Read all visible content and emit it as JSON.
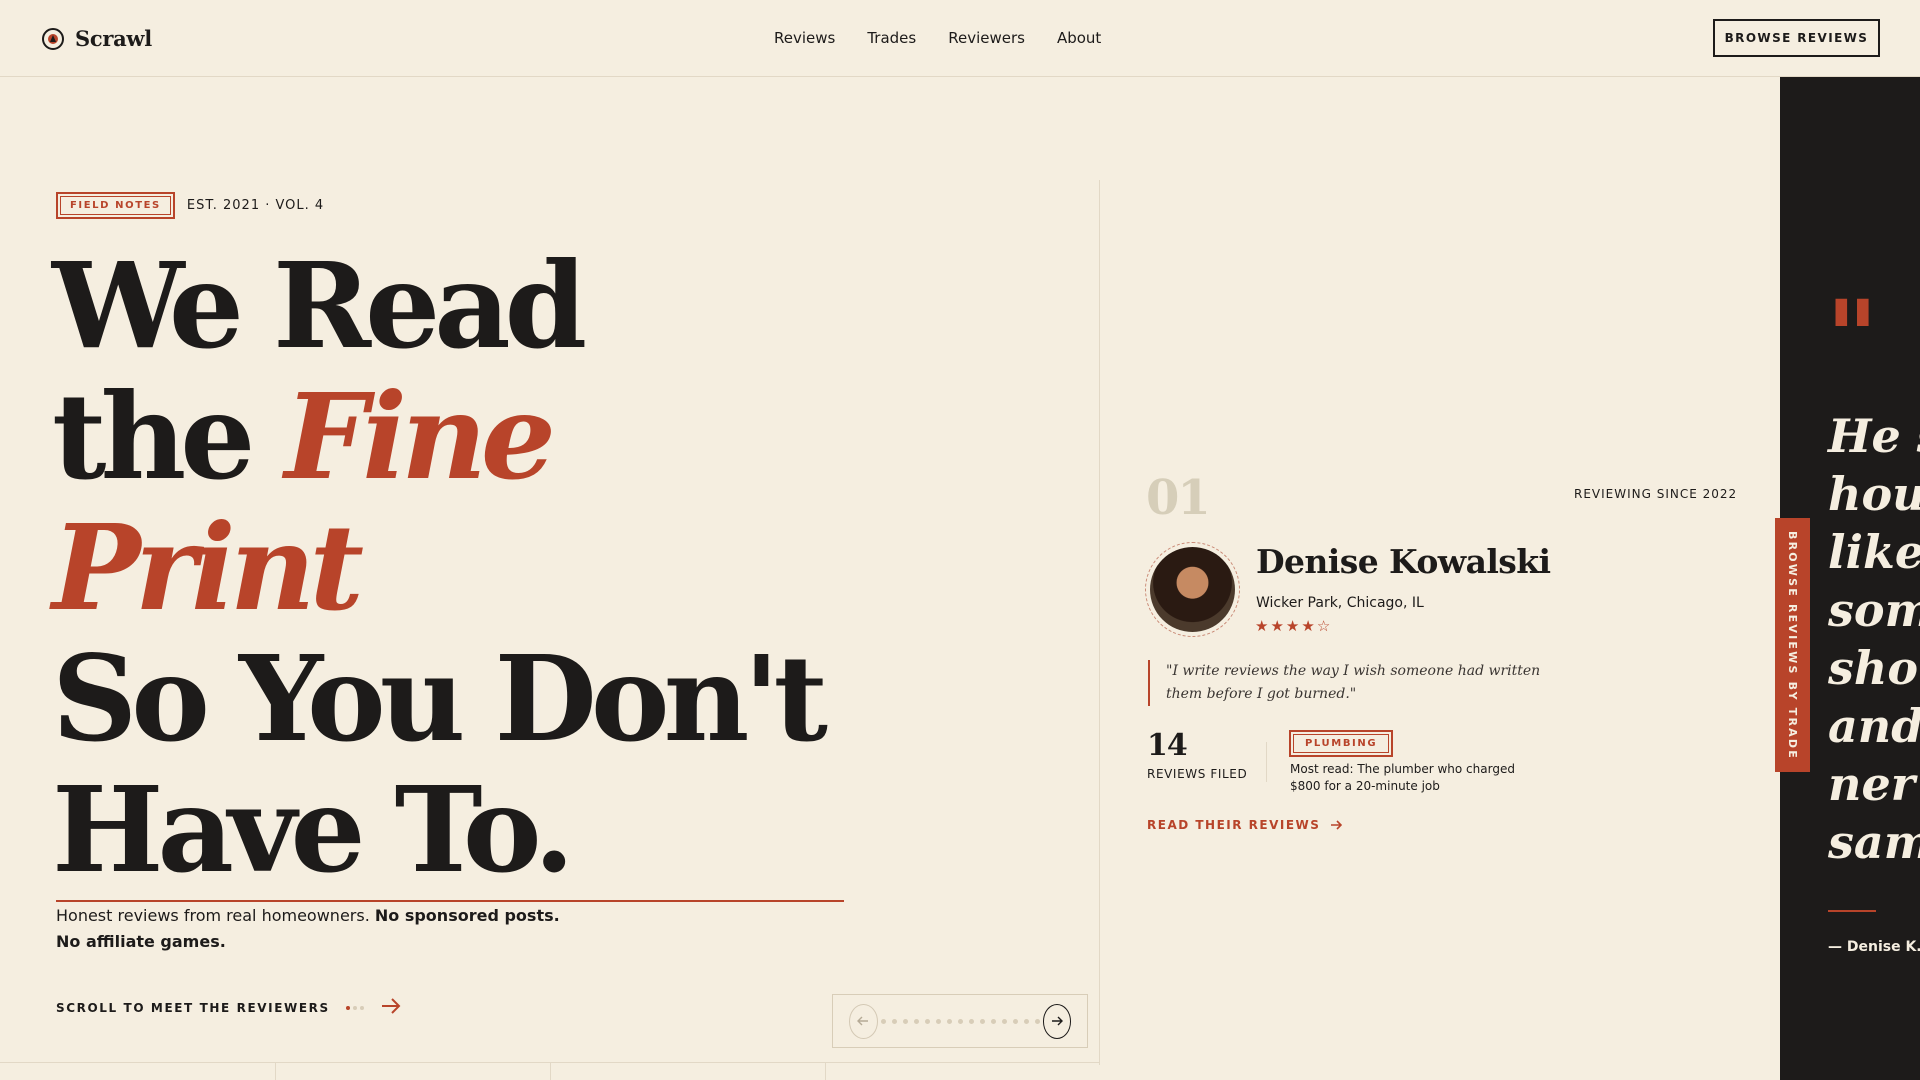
{
  "header": {
    "brand": "Scrawl",
    "nav": [
      "Reviews",
      "Trades",
      "Reviewers",
      "About"
    ],
    "cta": "BROWSE REVIEWS"
  },
  "hero": {
    "tag": "FIELD NOTES",
    "est": "EST. 2021 · VOL. 4",
    "headline": {
      "line1": "We Read",
      "line2a": "the ",
      "line2b": "Fine",
      "line3": "Print",
      "line4": "So You Don't",
      "line5": "Have To."
    },
    "subcopy_plain": "Honest reviews from real homeowners. ",
    "subcopy_bold": "No sponsored posts. No affiliate games.",
    "scroll_label": "SCROLL TO MEET THE REVIEWERS"
  },
  "reviewer": {
    "number": "01",
    "since": "REVIEWING SINCE 2022",
    "name": "Denise Kowalski",
    "location": "Wicker Park, Chicago, IL",
    "rating": 4,
    "rating_max": 5,
    "quote": "\"I write reviews the way I wish someone had written them before I got burned.\"",
    "reviews_count": "14",
    "reviews_label": "REVIEWS FILED",
    "trade": "PLUMBING",
    "most_read": "Most read: The plumber who charged $800 for a 20-minute job",
    "link": "READ THEIR REVIEWS"
  },
  "pager": {
    "pages": 15
  },
  "featured_quote": {
    "text": "He s\nhou\nlike\nsom\nsho\nand\nner\nsam",
    "attribution": "— Denise K., C"
  },
  "side_tab": "BROWSE REVIEWS BY TRADE",
  "colors": {
    "accent": "#b8442a",
    "background": "#f5eee0",
    "ink": "#1d1b1a"
  }
}
